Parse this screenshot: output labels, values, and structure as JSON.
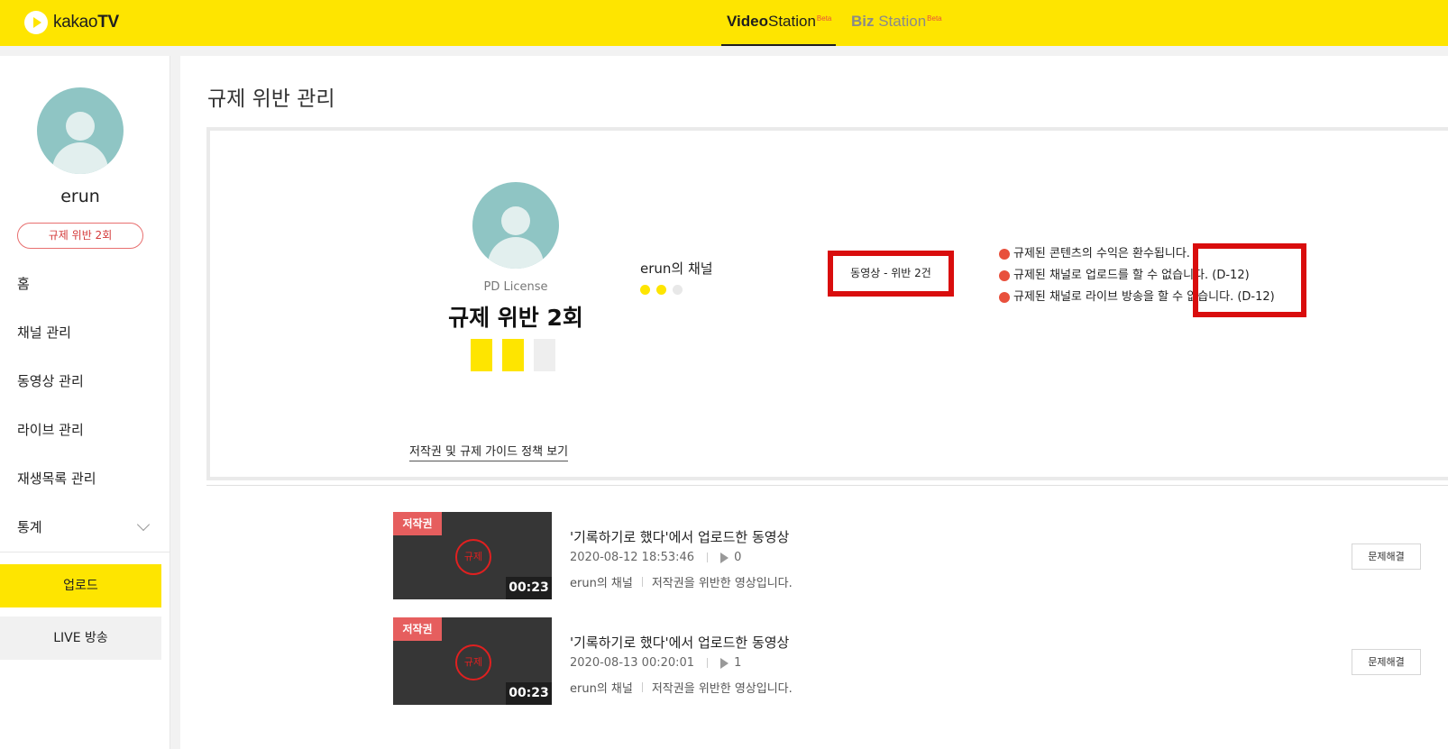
{
  "header": {
    "logo_text_regular": "kakao",
    "logo_text_bold": "TV",
    "tabs": [
      {
        "bold": "Video",
        "rest": "Station",
        "sup": "Beta"
      },
      {
        "bold": "Biz",
        "rest": " Station",
        "sup": "Beta"
      }
    ]
  },
  "sidebar": {
    "user_name": "erun",
    "violation_badge": "규제 위반 2회",
    "menu": [
      {
        "label": "홈"
      },
      {
        "label": "채널 관리"
      },
      {
        "label": "동영상 관리"
      },
      {
        "label": "라이브 관리"
      },
      {
        "label": "재생목록 관리"
      },
      {
        "label": "통계"
      }
    ],
    "upload_label": "업로드",
    "live_label": "LIVE 방송"
  },
  "main": {
    "page_title": "규제 위반 관리",
    "card": {
      "pd_label": "PD License",
      "pd_violation_count": "규제 위반 2회",
      "squares_filled": 2,
      "squares_total": 3,
      "channel_name": "erun의 채널",
      "dots_filled": 2,
      "dots_total": 3,
      "violation_summary": "동영상 - 위반 2건",
      "notes": [
        "규제된 콘텐츠의 수익은 환수됩니다.",
        "규제된 채널로 업로드를 할 수 없습니다. (D-12)",
        "규제된 채널로 라이브 방송을 할 수 없습니다. (D-12)"
      ]
    },
    "guide_link": "저작권 및 규제 가이드 정책 보기",
    "videos": [
      {
        "tag": "저작권",
        "seal": "규제",
        "duration": "00:23",
        "title": "'기록하기로 했다'에서 업로드한 동영상",
        "datetime": "2020-08-12 18:53:46",
        "plays": "0",
        "channel": "erun의 채널",
        "reason": "저작권을 위반한 영상입니다.",
        "action": "문제해결"
      },
      {
        "tag": "저작권",
        "seal": "규제",
        "duration": "00:23",
        "title": "'기록하기로 했다'에서 업로드한 동영상",
        "datetime": "2020-08-13 00:20:01",
        "plays": "1",
        "channel": "erun의 채널",
        "reason": "저작권을 위반한 영상입니다.",
        "action": "문제해결"
      }
    ]
  },
  "colors": {
    "brand_yellow": "#fee500",
    "alert_red": "#e8503c",
    "highlight_red": "#d90d0d"
  }
}
